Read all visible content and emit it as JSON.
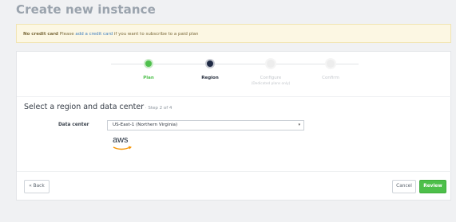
{
  "page": {
    "title": "Create new instance"
  },
  "alert": {
    "strong": "No credit card",
    "text_before": " Please ",
    "link": "add a credit card",
    "text_after": " if you want to subscribe to a paid plan"
  },
  "stepper": {
    "steps": [
      {
        "label": "Plan",
        "state": "done"
      },
      {
        "label": "Region",
        "state": "active"
      },
      {
        "label": "Configure",
        "sub": "(Dedicated plans only)",
        "state": "future"
      },
      {
        "label": "Confirm",
        "state": "future"
      }
    ]
  },
  "section": {
    "title": "Select a region and data center",
    "step_info": " · Step 2 of 4"
  },
  "datacenter": {
    "label": "Data center",
    "selected": "US-East-1 (Northern Virginia)",
    "caret": "▾",
    "provider_logo": "aws"
  },
  "buttons": {
    "back": "« Back",
    "cancel": "Cancel",
    "review": "Review"
  },
  "colors": {
    "success": "#4dbf4a",
    "active_step": "#1f2a44",
    "link": "#3f7fbf"
  }
}
